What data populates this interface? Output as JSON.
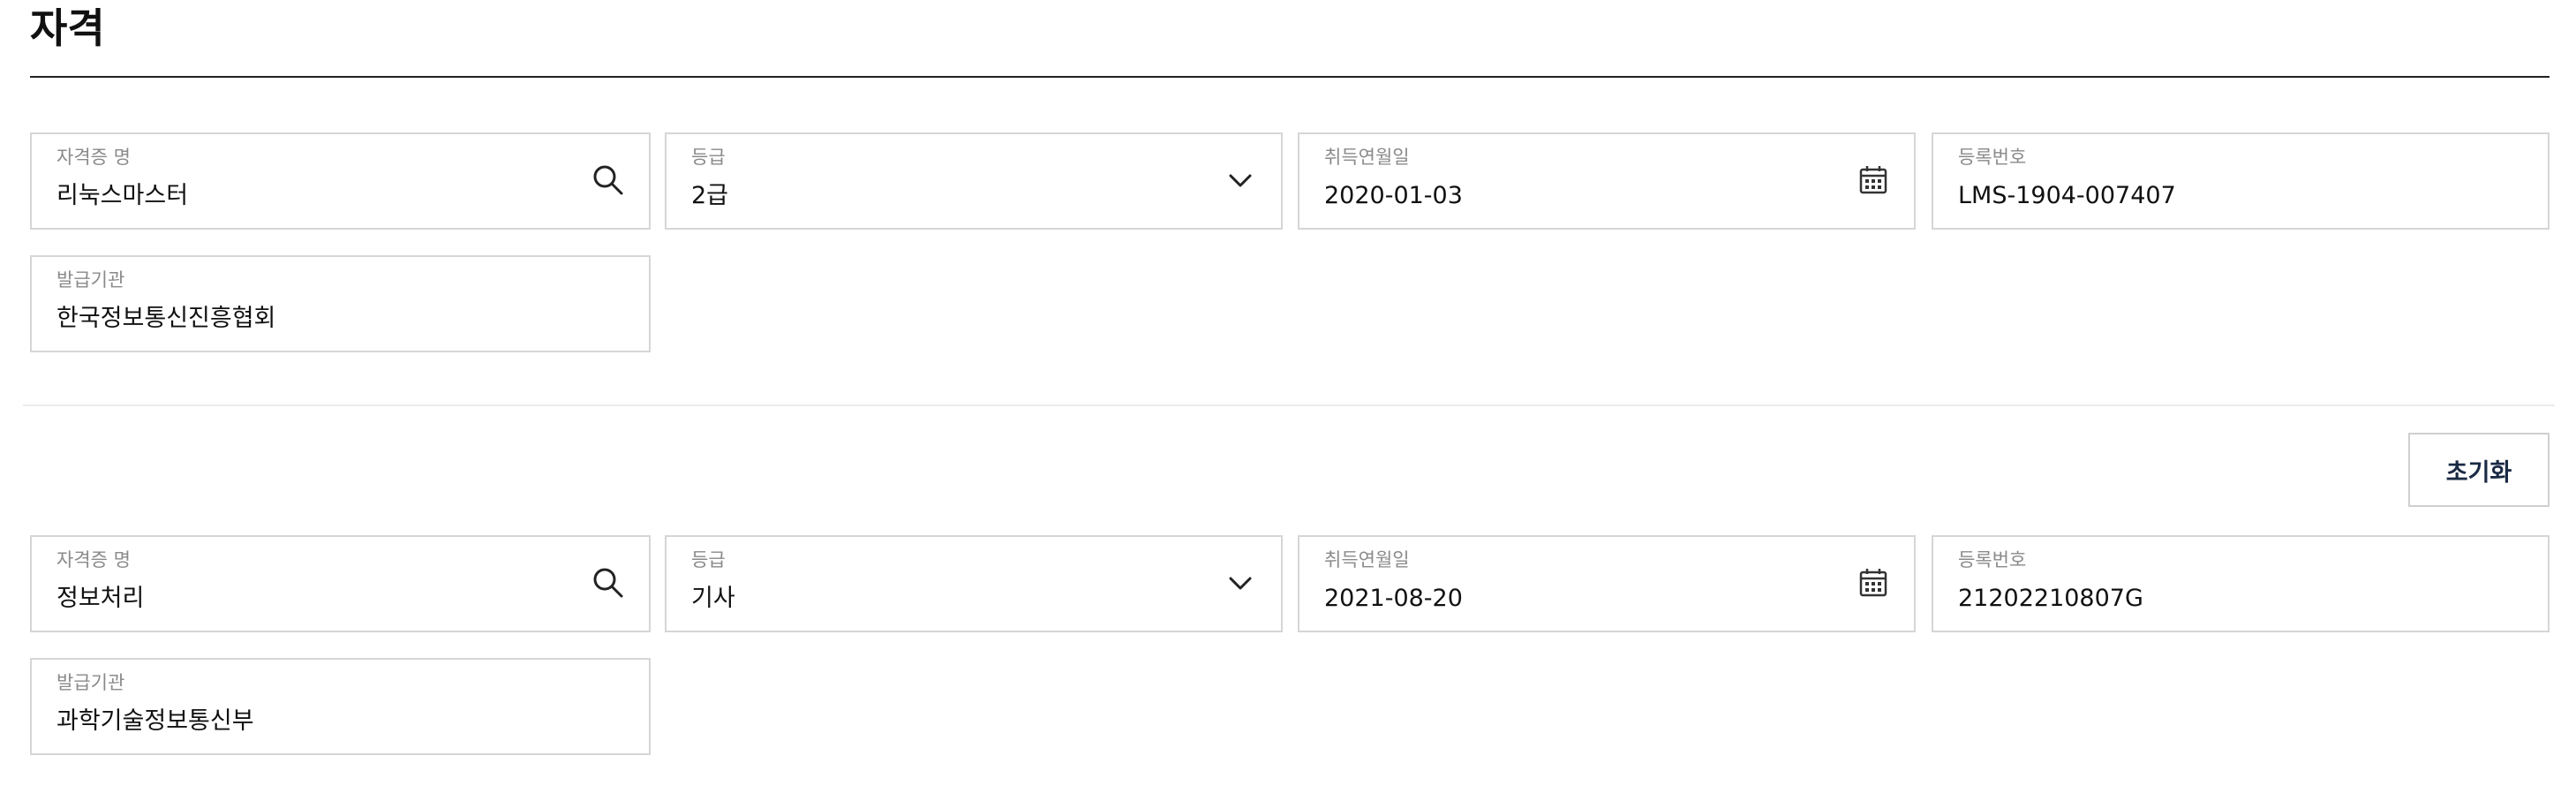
{
  "section": {
    "title": "자격"
  },
  "labels": {
    "cert_name": "자격증 명",
    "grade": "등급",
    "acquired_date": "취득연월일",
    "reg_number": "등록번호",
    "issuer": "발급기관"
  },
  "reset_button": {
    "label": "초기화"
  },
  "certificates": [
    {
      "cert_name": "리눅스마스터",
      "grade": "2급",
      "acquired_date": "2020-01-03",
      "reg_number": "LMS-1904-007407",
      "issuer": "한국정보통신진흥협회"
    },
    {
      "cert_name": "정보처리",
      "grade": "기사",
      "acquired_date": "2021-08-20",
      "reg_number": "21202210807G",
      "issuer": "과학기술정보통신부"
    }
  ],
  "icons": {
    "cert_name": "search-icon",
    "grade": "chevron-down-icon",
    "acquired_date": "calendar-icon"
  }
}
